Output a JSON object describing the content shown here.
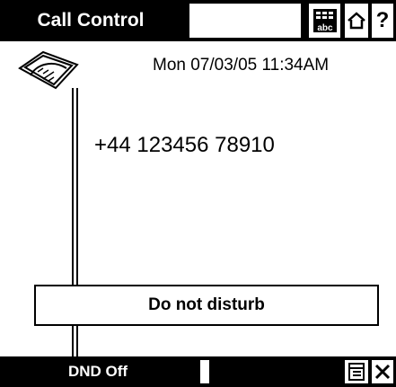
{
  "header": {
    "title": "Call Control",
    "abc_label": "abc",
    "help_label": "?"
  },
  "call": {
    "datetime": "Mon 07/03/05 11:34AM",
    "number": "+44 123456 78910"
  },
  "status": {
    "message": "Do not disturb"
  },
  "softkeys": {
    "left_label": "DND Off"
  },
  "icons": [
    "keypad-abc-icon",
    "home-icon",
    "help-icon",
    "telephone-icon",
    "list-icon",
    "close-icon"
  ]
}
